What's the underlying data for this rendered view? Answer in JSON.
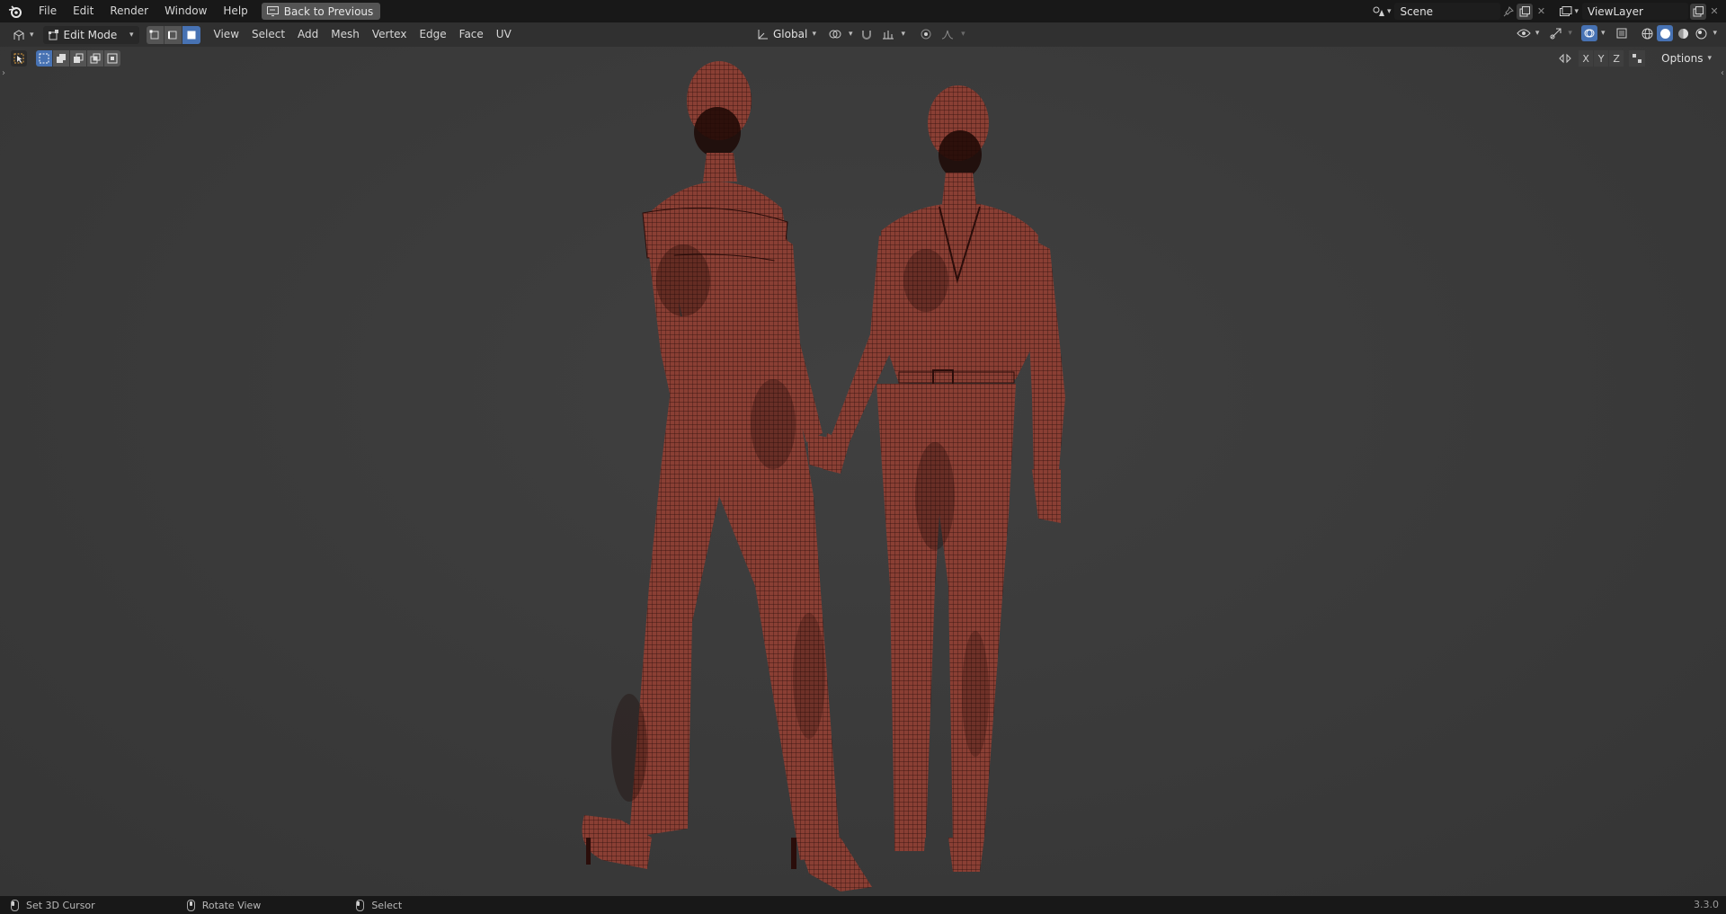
{
  "topbar": {
    "menus": [
      "File",
      "Edit",
      "Render",
      "Window",
      "Help"
    ],
    "back_button": "Back to Previous",
    "scene_name": "Scene",
    "view_layer": "ViewLayer"
  },
  "header": {
    "mode": "Edit Mode",
    "menus": [
      "View",
      "Select",
      "Add",
      "Mesh",
      "Vertex",
      "Edge",
      "Face",
      "UV"
    ],
    "orientation": "Global",
    "active_select_mode": "face"
  },
  "viewport": {
    "axes": [
      "X",
      "Y",
      "Z"
    ],
    "options_label": "Options",
    "mesh_color": "#8a3f34",
    "wire_color": "#2a0d0a"
  },
  "statusbar": {
    "left_click": "Set 3D Cursor",
    "middle_click": "Rotate View",
    "right_click": "Select",
    "version": "3.3.0"
  },
  "colors": {
    "accent": "#4772b3",
    "viewport_bg": "#393939",
    "topbar_bg": "#181818"
  }
}
